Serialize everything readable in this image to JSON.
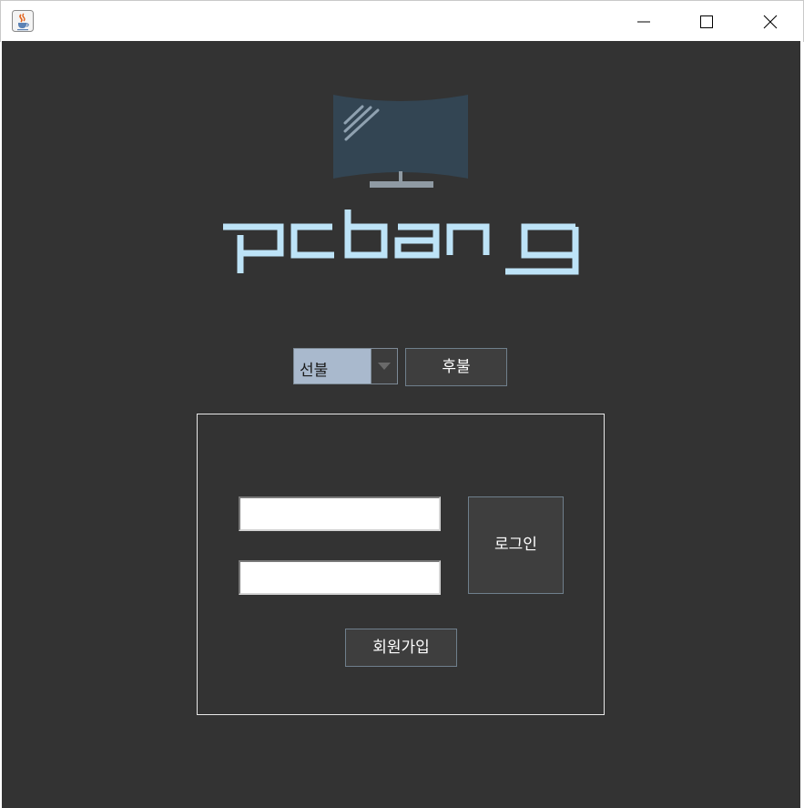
{
  "window": {
    "icon": "java-cup-icon",
    "controls": [
      "minimize-icon",
      "maximize-icon",
      "close-icon"
    ]
  },
  "logo": {
    "text": "pcbang",
    "icon": "monitor-icon",
    "text_color": "#bde3f7",
    "monitor_color": "#334553"
  },
  "payment": {
    "prepaid_selected": "선불",
    "postpay_label": "후불"
  },
  "login": {
    "id_value": "",
    "password_value": "",
    "login_label": "로그인",
    "signup_label": "회원가입"
  },
  "colors": {
    "background": "#333333",
    "select_bg": "#a9b9cd",
    "button_bg": "#3e3e3e"
  }
}
